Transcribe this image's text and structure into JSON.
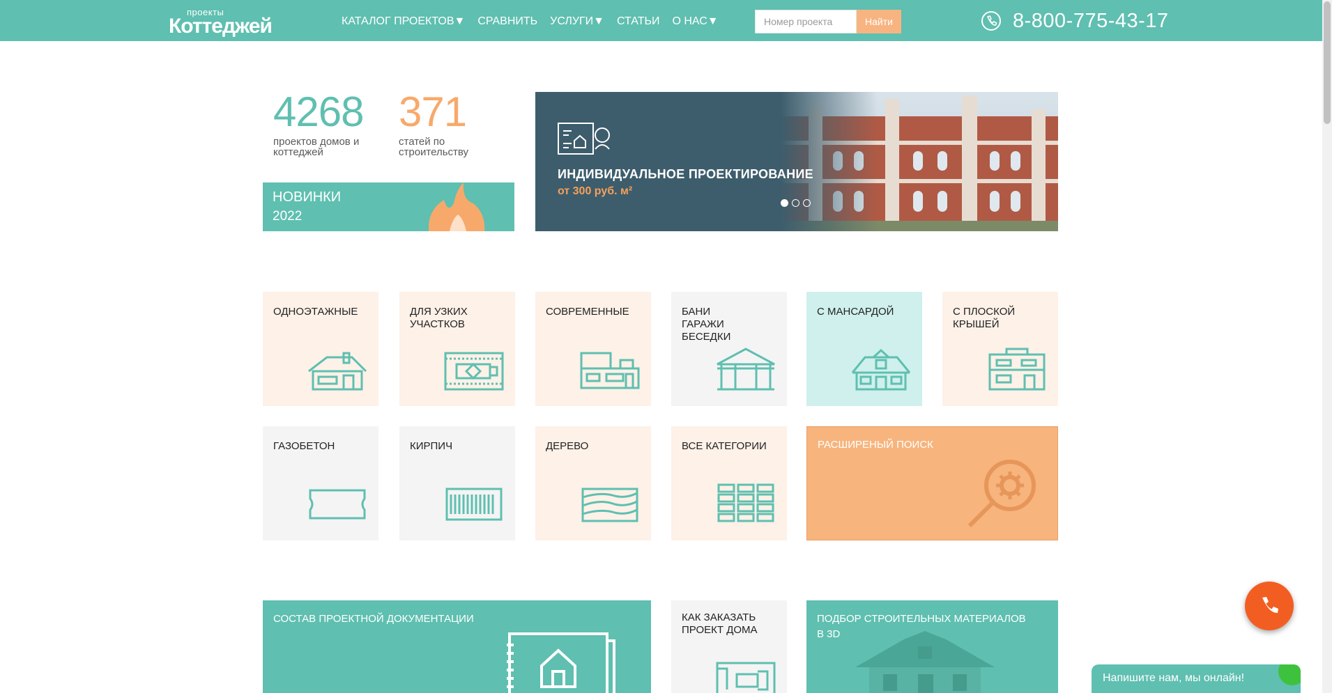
{
  "header": {
    "logo_small": "проекты",
    "logo_big": "Коттеджей",
    "nav": [
      {
        "label": "КАТАЛОГ ПРОЕКТОВ▼"
      },
      {
        "label": "СРАВНИТЬ"
      },
      {
        "label": "УСЛУГИ▼"
      },
      {
        "label": "СТАТЬИ"
      },
      {
        "label": "О НАС▼"
      }
    ],
    "search_placeholder": "Номер проекта",
    "search_button": "Найти",
    "phone": "8-800-775-43-17",
    "phone_icon": "phone-icon"
  },
  "stats": [
    {
      "value": "4268",
      "label": "проектов домов и коттеджей",
      "color": "#5fbfb0"
    },
    {
      "value": "371",
      "label": "статей по строительству",
      "color": "#f7a96b"
    }
  ],
  "news": {
    "title": "НОВИНКИ",
    "year": "2022",
    "icon": "flame-icon"
  },
  "banner": {
    "title": "ИНДИВИДУАЛЬНОЕ ПРОЕКТИРОВАНИЕ",
    "price": "от   300 руб. м²",
    "slides_total": 3,
    "active_slide": 1
  },
  "categories_row1": [
    {
      "label": "ОДНОЭТАЖНЫЕ",
      "icon": "one-storey-house-icon"
    },
    {
      "label": "ДЛЯ УЗКИХ\nУЧАСТКОВ",
      "icon": "narrow-plot-icon"
    },
    {
      "label": "СОВРЕМЕННЫЕ",
      "icon": "modern-house-icon"
    },
    {
      "label": "БАНИ\nГАРАЖИ\nБЕСЕДКИ",
      "icon": "gazebo-icon"
    },
    {
      "label": "С МАНСАРДОЙ",
      "icon": "attic-house-icon"
    },
    {
      "label": "С ПЛОСКОЙ\nКРЫШЕЙ",
      "icon": "flat-roof-house-icon"
    }
  ],
  "categories_row2": [
    {
      "label": "ГАЗОБЕТОН",
      "icon": "aerated-block-icon"
    },
    {
      "label": "КИРПИЧ",
      "icon": "brick-icon"
    },
    {
      "label": "ДЕРЕВО",
      "icon": "wood-icon"
    },
    {
      "label": "ВСЕ КАТЕГОРИИ",
      "icon": "grid-icon"
    }
  ],
  "advanced_search": {
    "label": "РАСШИРЕНЫЙ ПОИСК",
    "icon": "search-gear-icon"
  },
  "bottom": [
    {
      "label": "СОСТАВ ПРОЕКТНОЙ ДОКУМЕНТАЦИИ",
      "icon": "documents-icon"
    },
    {
      "label": "КАК ЗАКАЗАТЬ\nПРОЕКТ ДОМА",
      "icon": "plan-icon"
    },
    {
      "label": "ПОДБОР СТРОИТЕЛЬНЫХ МАТЕРИАЛОВ\nВ 3D",
      "icon": "house-3d-icon"
    }
  ],
  "chat": {
    "text": "Напишите нам, мы онлайн!"
  },
  "colors": {
    "accent": "#5fbfb0",
    "orange": "#f7b480",
    "peach": "#fdf1e8",
    "call": "#f25e22"
  }
}
